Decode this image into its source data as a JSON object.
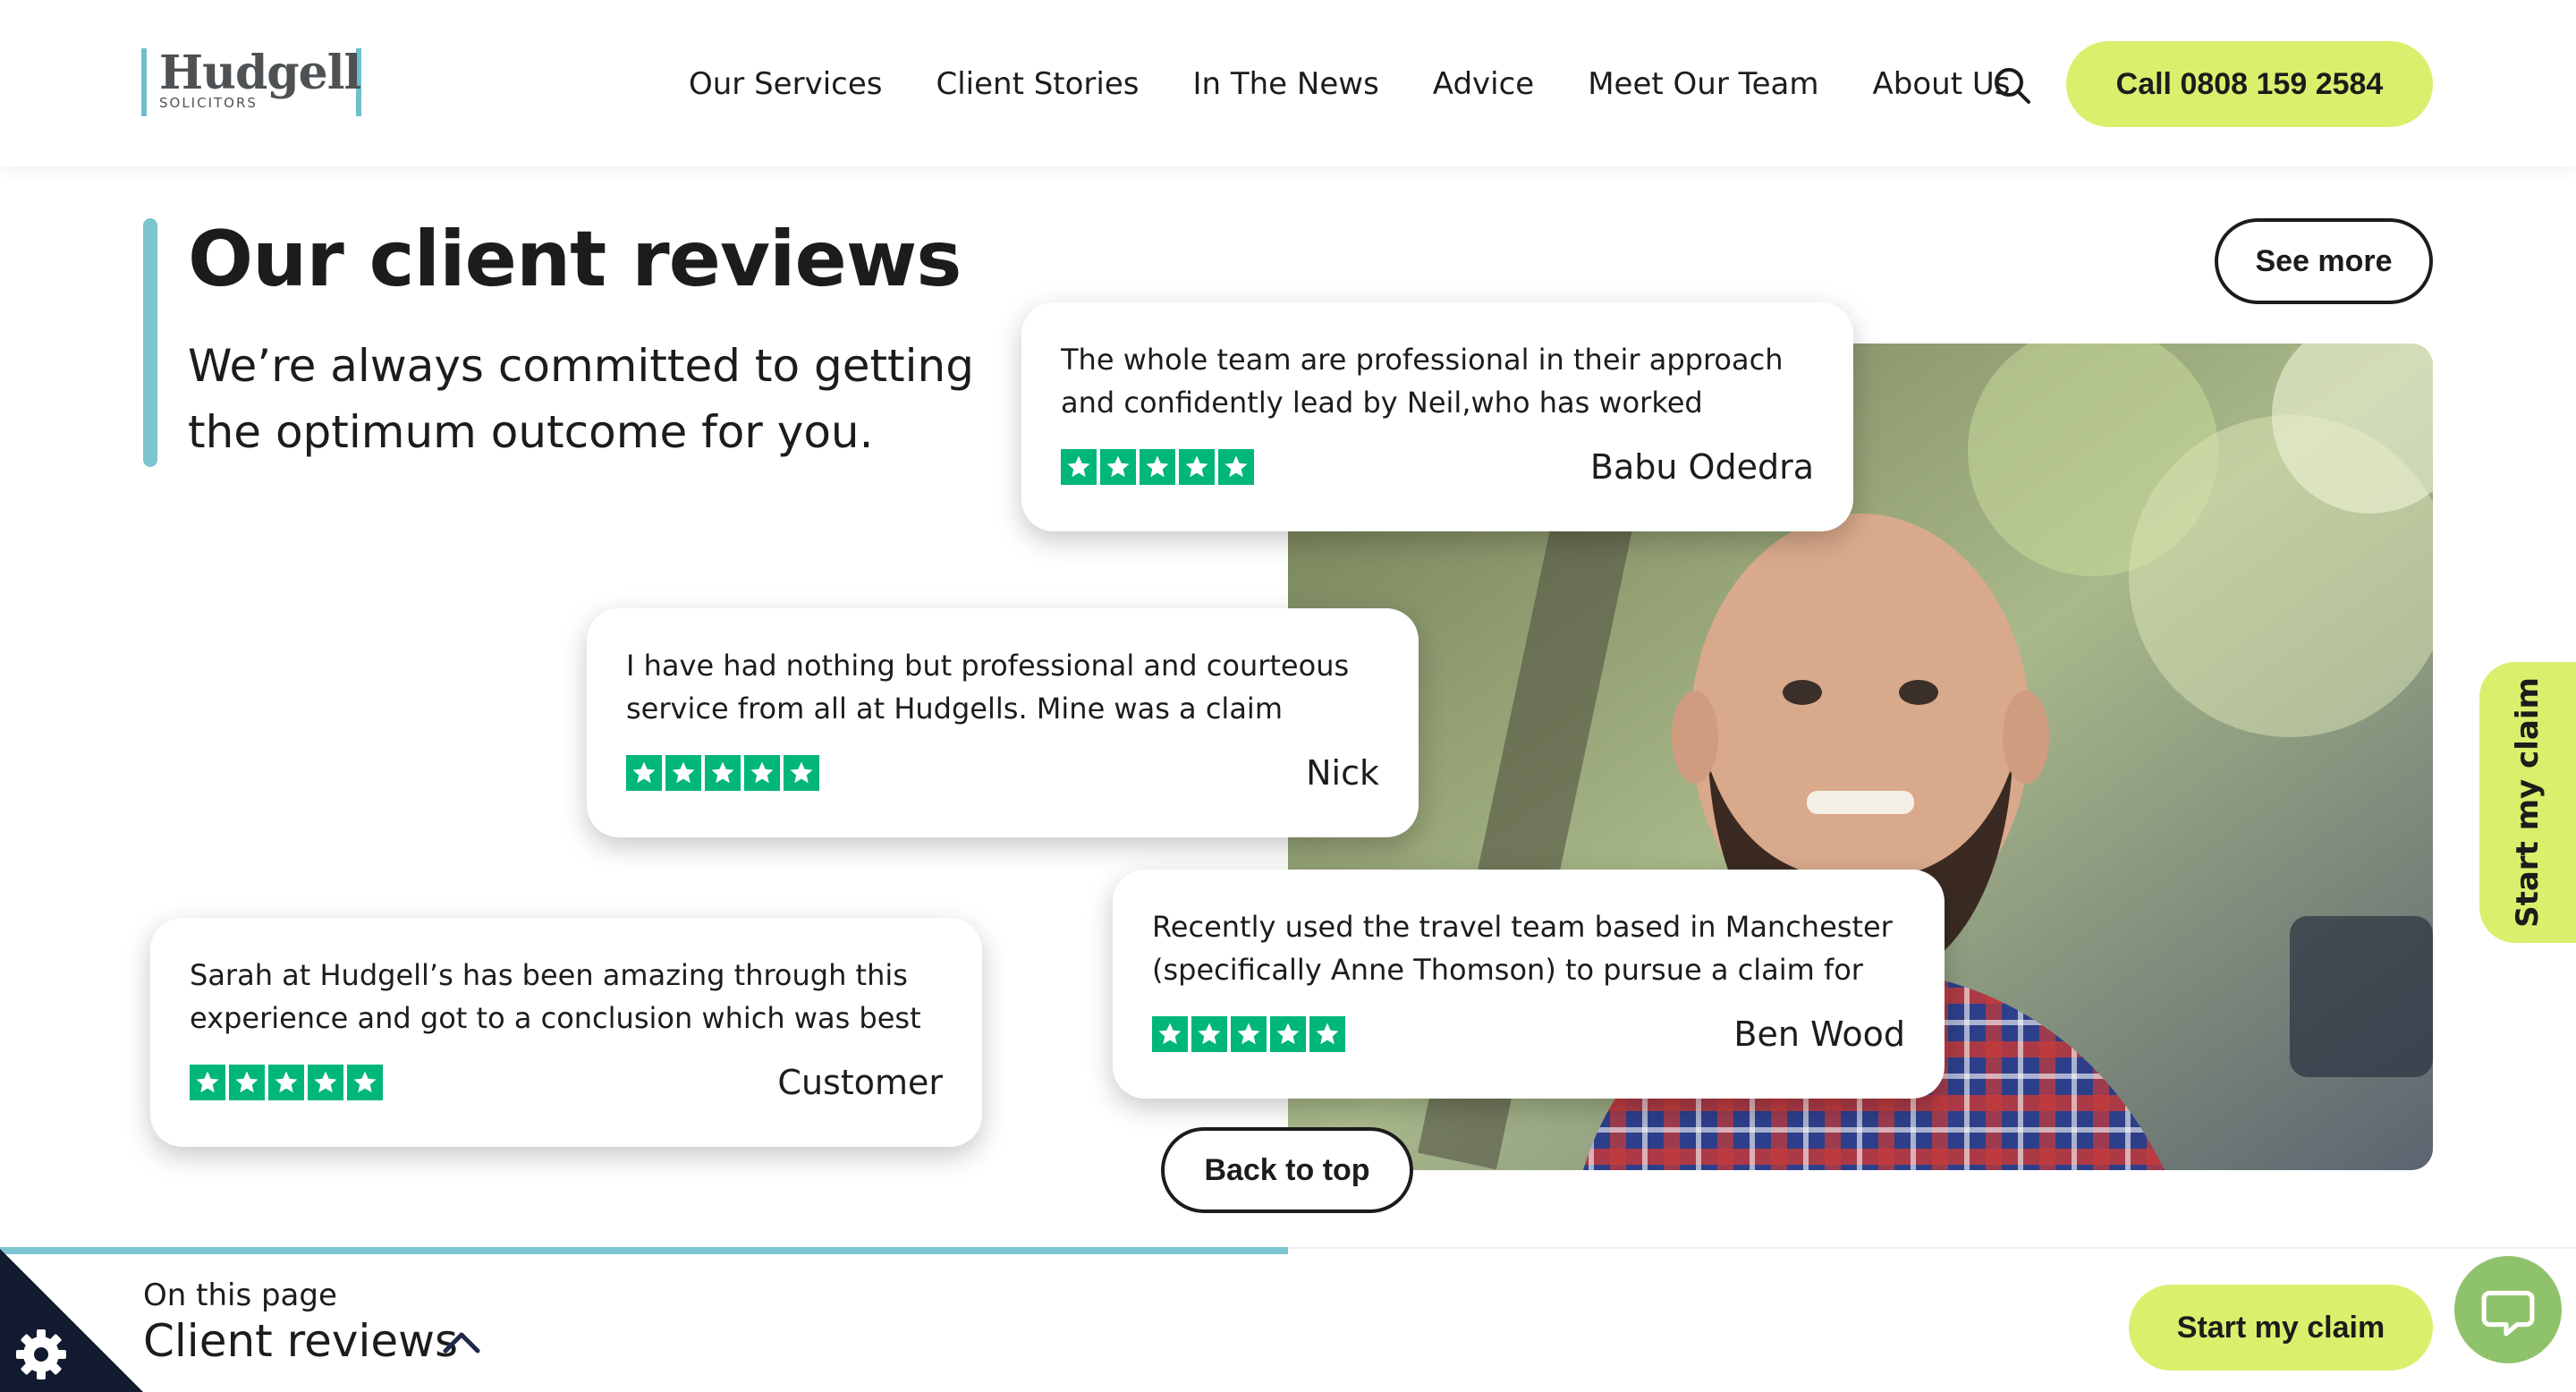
{
  "header": {
    "logo": {
      "name": "Hudgell",
      "sub": "SOLICITORS"
    },
    "nav": [
      "Our Services",
      "Client Stories",
      "In The News",
      "Advice",
      "Meet Our Team",
      "About Us"
    ],
    "call_label": "Call 0808 159 2584"
  },
  "section": {
    "title": "Our client reviews",
    "subtitle": "We’re always committed to getting the optimum outcome for you.",
    "see_more": "See more"
  },
  "reviews": [
    {
      "text": "The whole team are professional in their approach and confidently lead by Neil,who has worked tirelessly t...",
      "author": "Babu Odedra",
      "stars": 5
    },
    {
      "text": "I have had nothing but professional and courteous service from all at Hudgells. Mine was a claim agains...",
      "author": "Nick",
      "stars": 5
    },
    {
      "text": "Recently used the travel team based in Manchester (specifically Anne Thomson) to pursue a claim for my...",
      "author": "Ben Wood",
      "stars": 5
    },
    {
      "text": "Sarah at Hudgell’s has been amazing through this experience and got to a conclusion which was best f...",
      "author": "Customer",
      "stars": 5
    }
  ],
  "back_to_top": "Back to top",
  "side_tab": "Start my claim",
  "bottom_bar": {
    "label": "On this page",
    "value": "Client reviews",
    "start_claim": "Start my claim",
    "progress": 0.5
  },
  "colors": {
    "accent": "#7cc4d0",
    "cta": "#dcef6d",
    "star": "#00b67a",
    "chat": "#8fc36b"
  },
  "icons": [
    "search-icon",
    "star-icon",
    "chevron-up-icon",
    "cookie-gear-icon",
    "chat-icon"
  ]
}
